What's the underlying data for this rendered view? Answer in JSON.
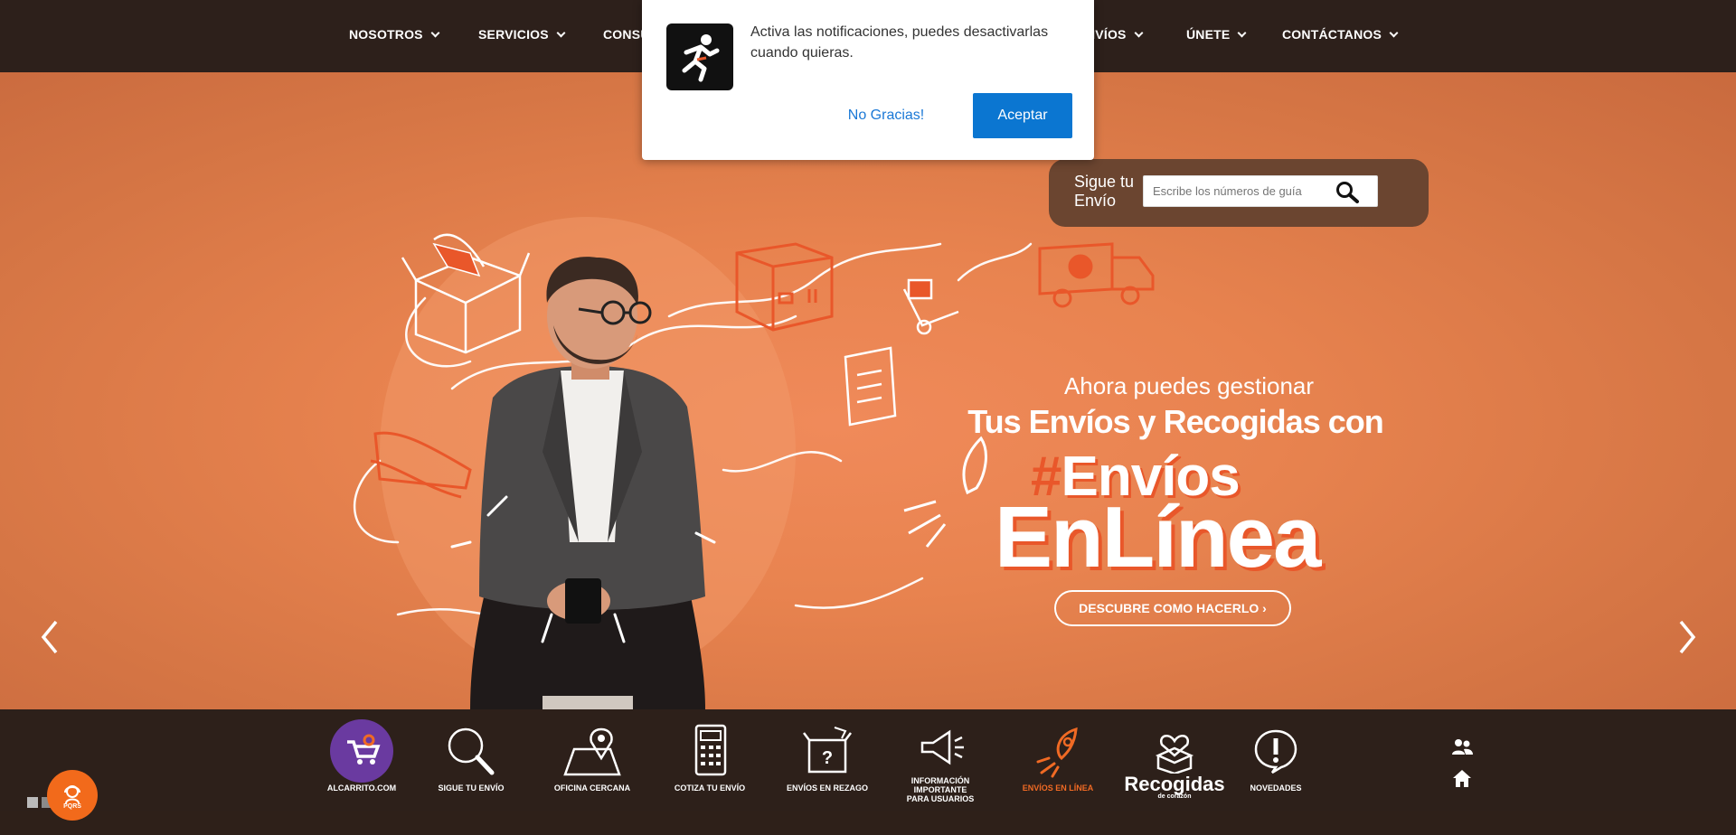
{
  "nav": {
    "items": [
      {
        "label": "NOSOTROS"
      },
      {
        "label": "SERVICIOS"
      },
      {
        "label": "CONSU"
      },
      {
        "label": "NVÍOS"
      },
      {
        "label": "ÚNETE"
      },
      {
        "label": "CONTÁCTANOS"
      }
    ]
  },
  "popup": {
    "message": "Activa las notificaciones, puedes desactivarlas cuando quieras.",
    "decline_label": "No Gracias!",
    "accept_label": "Aceptar",
    "logo_icon": "runner-logo-icon"
  },
  "tracking": {
    "label": "Sigue tu Envío",
    "placeholder": "Escribe los números de guía",
    "search_icon": "search-icon"
  },
  "hero": {
    "line1": "Ahora puedes gestionar",
    "line2": "Tus Envíos y Recogidas con",
    "line3_hash": "#",
    "line3": "Envíos",
    "line4": "EnLínea",
    "cta_label": "DESCUBRE COMO HACERLO"
  },
  "bottombar": {
    "items": [
      {
        "label": "ALCARRITO.COM",
        "icon": "cart-icon"
      },
      {
        "label": "SIGUE TU ENVÍO",
        "icon": "magnifier-icon"
      },
      {
        "label": "OFICINA CERCANA",
        "icon": "map-pin-icon"
      },
      {
        "label": "COTIZA TU ENVÍO",
        "icon": "calculator-icon"
      },
      {
        "label": "ENVÍOS EN REZAGO",
        "icon": "box-question-icon"
      },
      {
        "label": "INFORMACIÓN IMPORTANTE PARA USUARIOS",
        "icon": "megaphone-icon"
      },
      {
        "label": "ENVÍOS EN LÍNEA",
        "icon": "rocket-icon"
      },
      {
        "label": "Recogidas",
        "sublabel": "de corazón",
        "icon": "heart-box-icon"
      },
      {
        "label": "NOVEDADES",
        "icon": "alert-icon"
      }
    ]
  },
  "floating": {
    "pqrs_label": "PQRS",
    "pqrs_icon": "support-agent-icon"
  },
  "colors": {
    "nav_bg": "#2d201b",
    "hero_orange": "#e8834f",
    "accent_orange": "#f06a24",
    "accept_blue": "#0b76d1",
    "track_bg": "#6b4530"
  }
}
